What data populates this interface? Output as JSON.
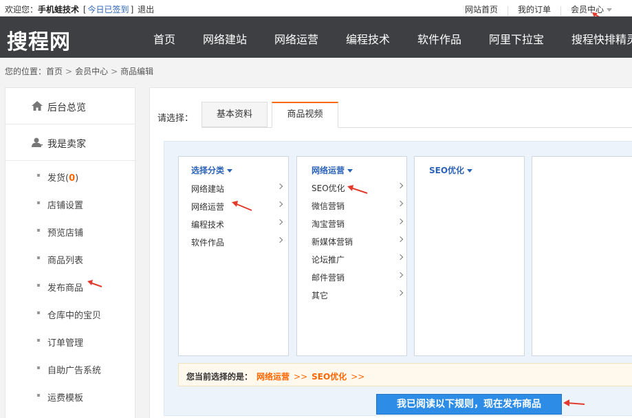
{
  "topbar": {
    "welcome": "欢迎您：",
    "username": "手机蛙技术",
    "signin": "今日已签到",
    "logout": "退出",
    "links": [
      "网站首页",
      "我的订单",
      "会员中心"
    ]
  },
  "header": {
    "logo": "搜程网",
    "nav": [
      "首页",
      "网络建站",
      "网络运营",
      "编程技术",
      "软件作品",
      "阿里下拉宝",
      "搜程快排精灵"
    ]
  },
  "breadcrumb": {
    "prefix": "您的位置：",
    "items": [
      "首页",
      "会员中心",
      "商品编辑"
    ]
  },
  "sidebar": {
    "main": [
      "后台总览",
      "我是卖家"
    ],
    "ship_label": "发货(",
    "ship_count": "0",
    "ship_close": ")",
    "items": [
      "店铺设置",
      "预览店铺",
      "商品列表",
      "发布商品",
      "仓库中的宝贝",
      "订单管理",
      "自助广告系统",
      "运费模板"
    ]
  },
  "main": {
    "choose_label": "请选择：",
    "tabs": [
      "基本资料",
      "商品视频"
    ],
    "col1": {
      "head": "选择分类",
      "items": [
        "网络建站",
        "网络运营",
        "编程技术",
        "软件作品"
      ]
    },
    "col2": {
      "head": "网络运营",
      "items": [
        "SEO优化",
        "微信营销",
        "淘宝营销",
        "新媒体营销",
        "论坛推广",
        "邮件营销",
        "其它"
      ]
    },
    "col3": {
      "head": "SEO优化"
    },
    "current_label": "您当前选择的是：",
    "current_sel1": "网络运营",
    "current_sep1": ">>",
    "current_sel2": "SEO优化",
    "current_sep2": ">>",
    "publish_button": "我已阅读以下规则，现在发布商品"
  },
  "colors": {
    "header_bg": "#3d3f42",
    "accent_orange": "#ff6600",
    "link_blue": "#2b63b7",
    "button_blue": "#2d8de6",
    "arrow_red": "#e23b2e"
  }
}
